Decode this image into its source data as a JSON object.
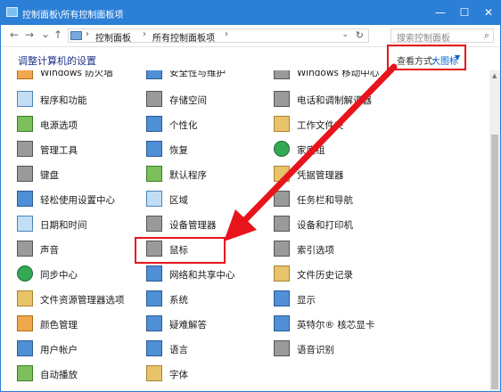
{
  "window": {
    "title": "控制面板\\所有控制面板项",
    "minimize": "—",
    "maximize": "☐",
    "close": "✕"
  },
  "nav": {
    "back": "←",
    "forward": "→",
    "recent": "⌄",
    "up": "↑",
    "breadcrumb": [
      "控制面板",
      "所有控制面板项"
    ],
    "separator": "›",
    "dropdown": "⌄",
    "refresh": "↻",
    "search_placeholder": "搜索控制面板",
    "search_icon": "⌕"
  },
  "header": {
    "title": "调整计算机的设置",
    "view_by_label": "查看方式:",
    "view_by_value": "大图标",
    "view_by_caret": "▼"
  },
  "items": [
    {
      "name": "windows-defender",
      "label": "Windows 防火墙",
      "icon": "firewall-icon"
    },
    {
      "name": "security-maintenance",
      "label": "安全性与维护",
      "icon": "flag-icon"
    },
    {
      "name": "windows-mobility",
      "label": "Windows 移动中心",
      "icon": "mobility-icon"
    },
    {
      "name": "programs-features",
      "label": "程序和功能",
      "icon": "programs-icon"
    },
    {
      "name": "storage-spaces",
      "label": "存储空间",
      "icon": "storage-icon"
    },
    {
      "name": "phone-modem",
      "label": "电话和调制解调器",
      "icon": "phone-icon"
    },
    {
      "name": "power-options",
      "label": "电源选项",
      "icon": "power-icon"
    },
    {
      "name": "personalization",
      "label": "个性化",
      "icon": "personalization-icon"
    },
    {
      "name": "work-folders",
      "label": "工作文件夹",
      "icon": "work-folder-icon"
    },
    {
      "name": "admin-tools",
      "label": "管理工具",
      "icon": "tools-icon"
    },
    {
      "name": "recovery",
      "label": "恢复",
      "icon": "recovery-icon"
    },
    {
      "name": "homegroup",
      "label": "家庭组",
      "icon": "homegroup-icon"
    },
    {
      "name": "keyboard",
      "label": "键盘",
      "icon": "keyboard-icon"
    },
    {
      "name": "default-programs",
      "label": "默认程序",
      "icon": "default-programs-icon"
    },
    {
      "name": "credential-manager",
      "label": "凭据管理器",
      "icon": "credential-icon"
    },
    {
      "name": "ease-of-access",
      "label": "轻松使用设置中心",
      "icon": "accessibility-icon"
    },
    {
      "name": "region",
      "label": "区域",
      "icon": "region-icon"
    },
    {
      "name": "taskbar-navigation",
      "label": "任务栏和导航",
      "icon": "taskbar-icon"
    },
    {
      "name": "date-time",
      "label": "日期和时间",
      "icon": "calendar-icon"
    },
    {
      "name": "device-manager",
      "label": "设备管理器",
      "icon": "device-manager-icon"
    },
    {
      "name": "devices-printers",
      "label": "设备和打印机",
      "icon": "printer-icon"
    },
    {
      "name": "sound",
      "label": "声音",
      "icon": "speaker-icon"
    },
    {
      "name": "mouse",
      "label": "鼠标",
      "icon": "mouse-icon"
    },
    {
      "name": "indexing-options",
      "label": "索引选项",
      "icon": "index-icon"
    },
    {
      "name": "sync-center",
      "label": "同步中心",
      "icon": "sync-icon"
    },
    {
      "name": "network-sharing",
      "label": "网络和共享中心",
      "icon": "network-icon"
    },
    {
      "name": "file-history",
      "label": "文件历史记录",
      "icon": "file-history-icon"
    },
    {
      "name": "file-explorer-options",
      "label": "文件资源管理器选项",
      "icon": "folder-options-icon"
    },
    {
      "name": "system",
      "label": "系统",
      "icon": "system-icon"
    },
    {
      "name": "display",
      "label": "显示",
      "icon": "display-icon"
    },
    {
      "name": "color-management",
      "label": "颜色管理",
      "icon": "color-icon"
    },
    {
      "name": "troubleshooting",
      "label": "疑难解答",
      "icon": "troubleshoot-icon"
    },
    {
      "name": "intel-graphics",
      "label": "英特尔® 核芯显卡",
      "icon": "intel-icon"
    },
    {
      "name": "user-accounts",
      "label": "用户帐户",
      "icon": "users-icon"
    },
    {
      "name": "language",
      "label": "语言",
      "icon": "language-icon"
    },
    {
      "name": "speech-recognition",
      "label": "语音识别",
      "icon": "microphone-icon"
    },
    {
      "name": "autoplay",
      "label": "自动播放",
      "icon": "autoplay-icon"
    },
    {
      "name": "fonts",
      "label": "字体",
      "icon": "fonts-icon"
    }
  ],
  "annotation_color": "#e8141c",
  "accent_color": "#2b7fd6"
}
